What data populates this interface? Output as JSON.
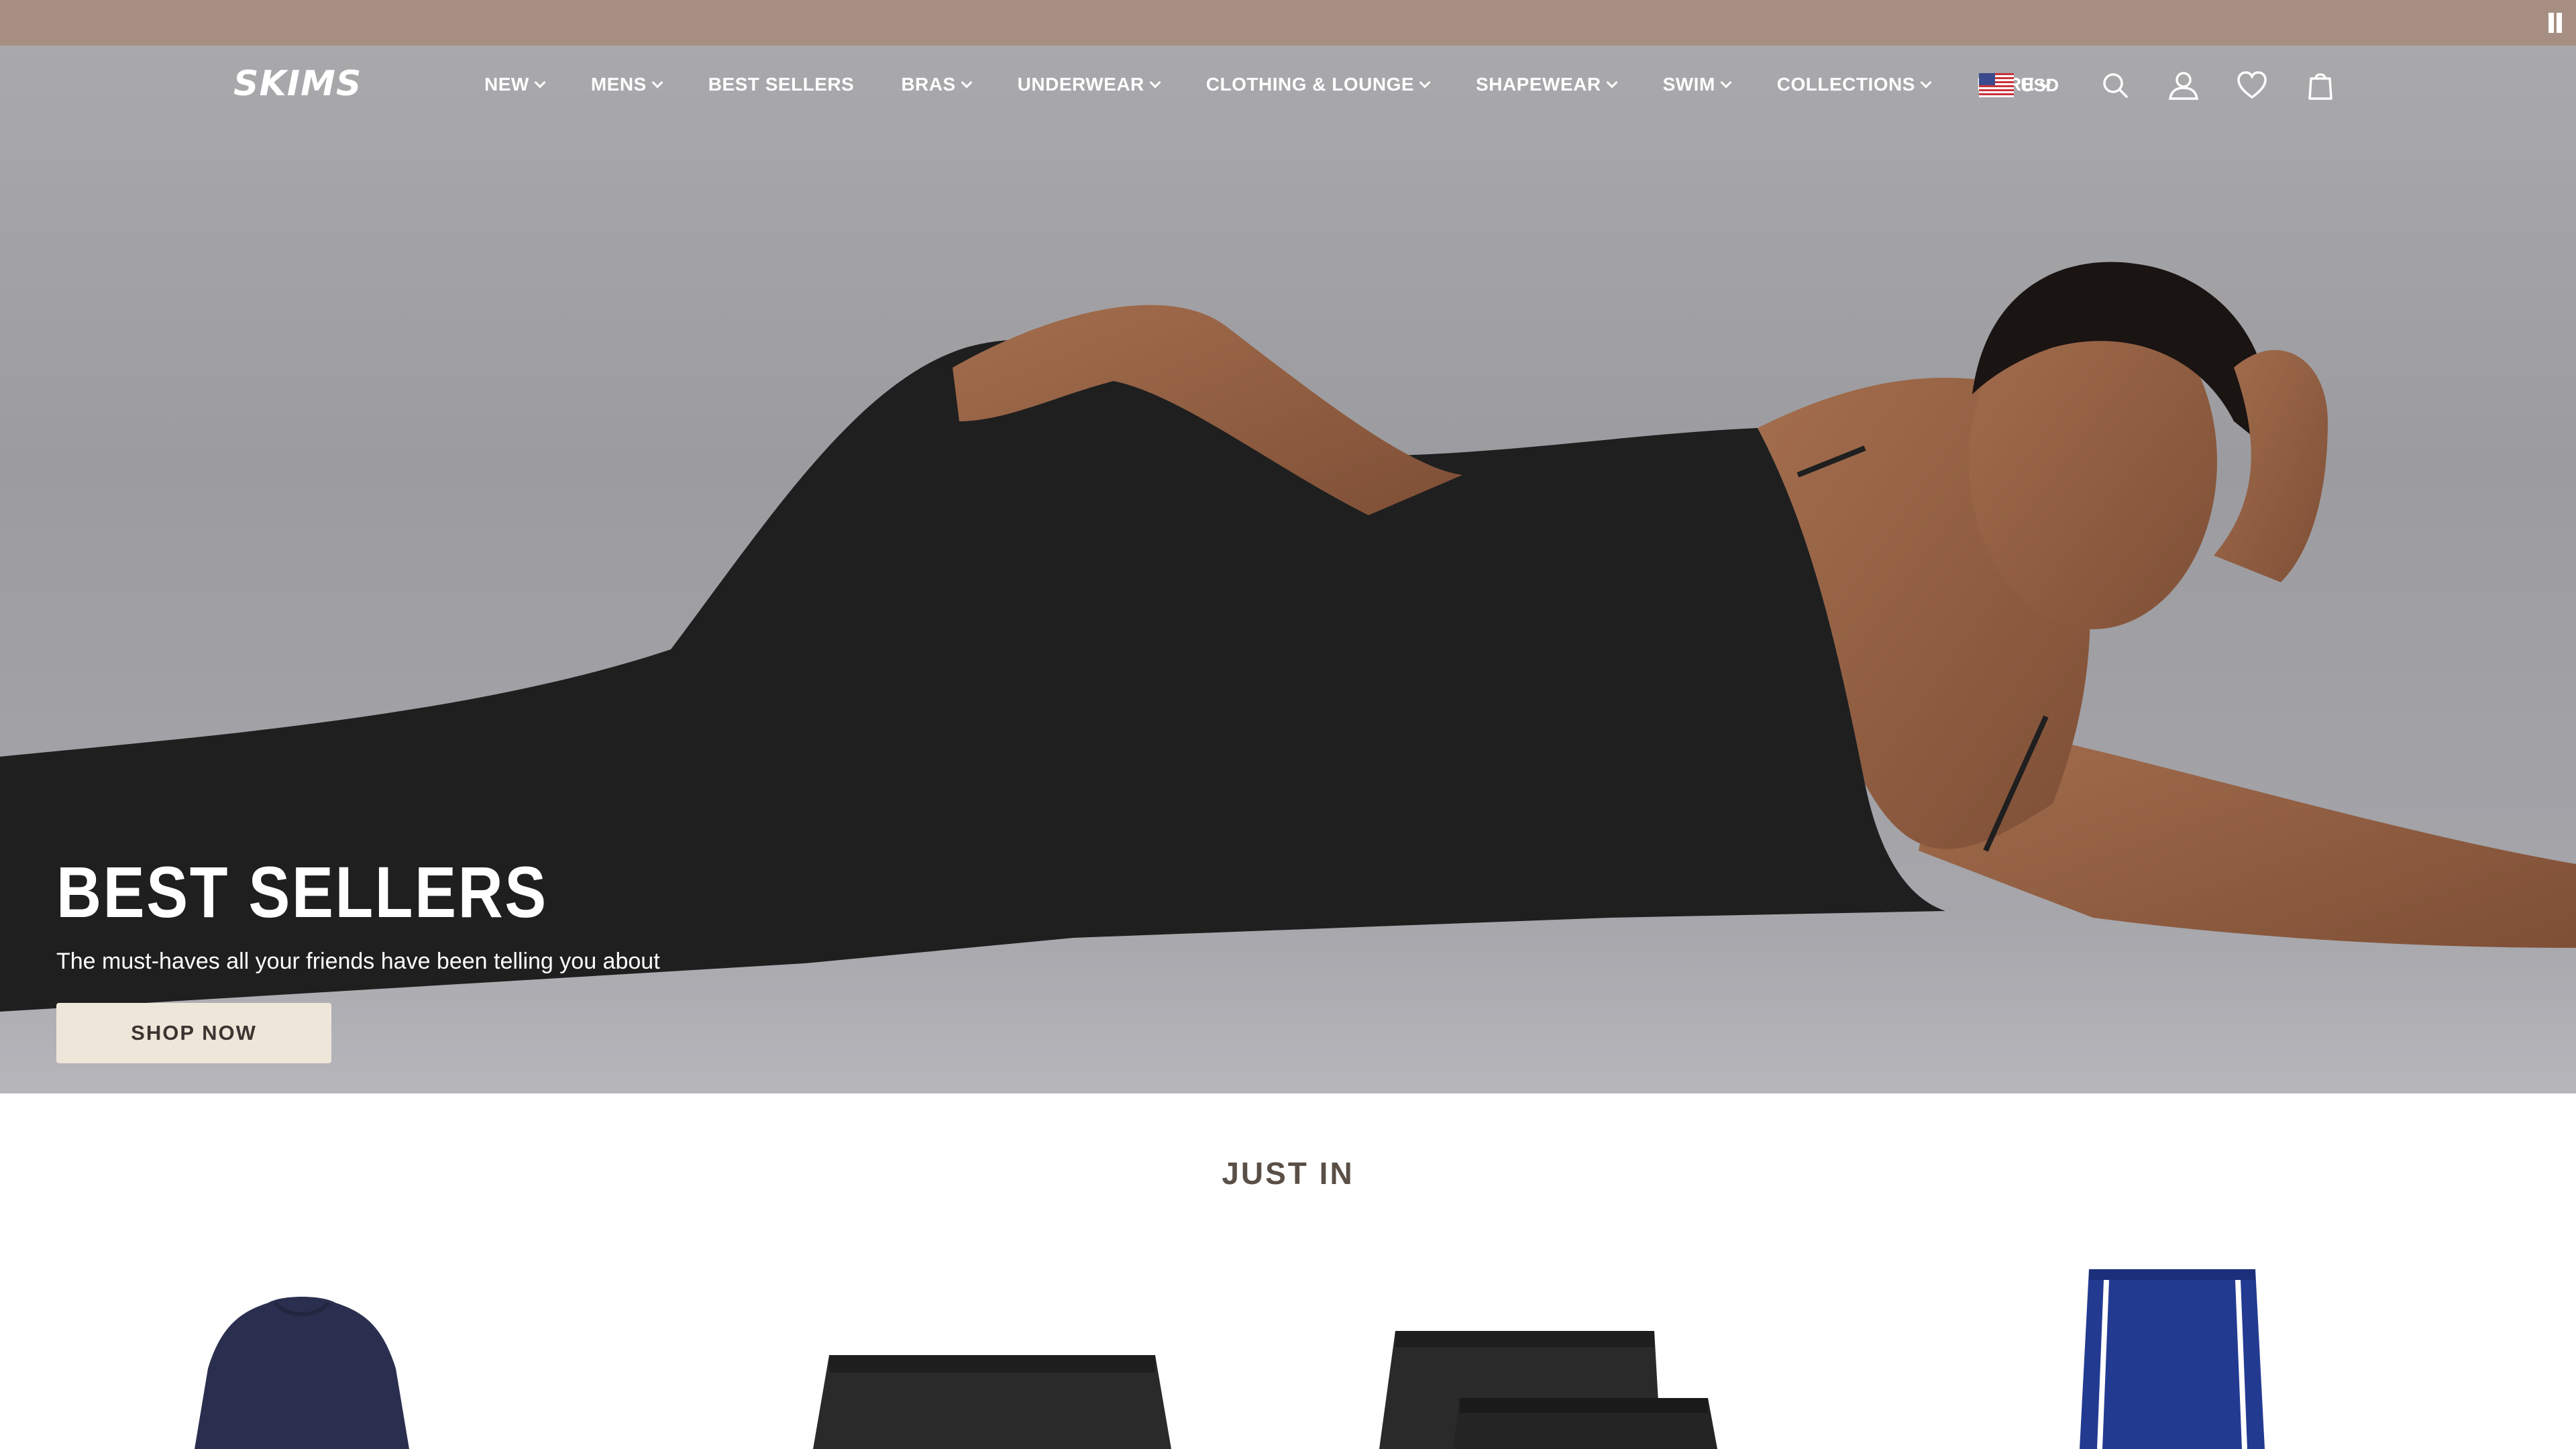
{
  "brand": {
    "logo_text": "SKIMS"
  },
  "nav": {
    "items": [
      {
        "label": "NEW",
        "has_dropdown": true
      },
      {
        "label": "MENS",
        "has_dropdown": true
      },
      {
        "label": "BEST SELLERS",
        "has_dropdown": false
      },
      {
        "label": "BRAS",
        "has_dropdown": true
      },
      {
        "label": "UNDERWEAR",
        "has_dropdown": true
      },
      {
        "label": "CLOTHING & LOUNGE",
        "has_dropdown": true
      },
      {
        "label": "SHAPEWEAR",
        "has_dropdown": true
      },
      {
        "label": "SWIM",
        "has_dropdown": true
      },
      {
        "label": "COLLECTIONS",
        "has_dropdown": true
      },
      {
        "label": "MORE",
        "has_dropdown": true
      }
    ]
  },
  "utility": {
    "currency_label": "USD",
    "flag_icon": "us-flag-icon",
    "icons": [
      "search-icon",
      "account-icon",
      "heart-icon",
      "shopping-bag-icon"
    ]
  },
  "hero": {
    "title": "BEST SELLERS",
    "subtitle": "The must-haves all your friends have been telling you about",
    "cta_label": "SHOP NOW",
    "slide_count": 2,
    "active_slide": 2
  },
  "just_in": {
    "title": "JUST IN",
    "products": [
      {
        "icon": "navy-tshirt-image",
        "color": "#2b2f4f"
      },
      {
        "icon": "black-boxer-brief-image",
        "color": "#2a2a2a"
      },
      {
        "icon": "black-boxer-brief-2-pack-image",
        "color": "#2a2a2a"
      },
      {
        "icon": "blue-shorts-image",
        "color": "#233a91"
      }
    ]
  },
  "colors": {
    "promo_bar": "#a68f82",
    "button_bg": "#efe6da",
    "section_title": "#5a4f46"
  }
}
